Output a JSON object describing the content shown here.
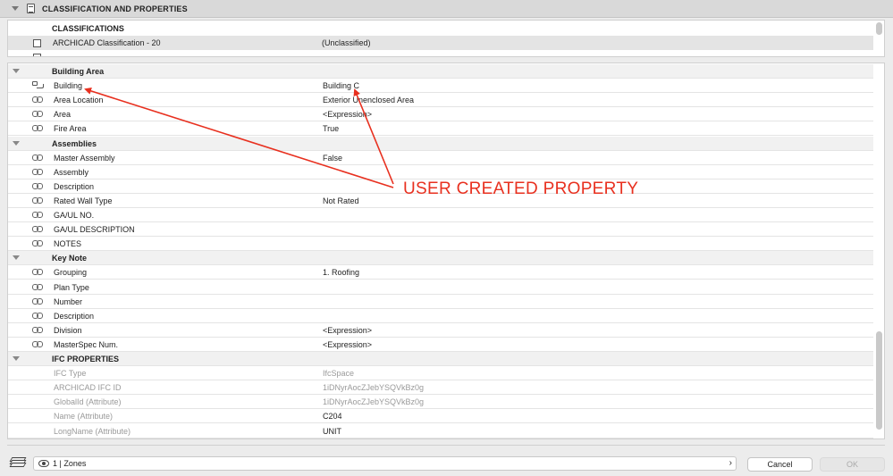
{
  "panel": {
    "title": "CLASSIFICATION AND PROPERTIES"
  },
  "classifications": {
    "header": "CLASSIFICATIONS",
    "row": {
      "name": "ARCHICAD Classification - 20",
      "value": "(Unclassified)"
    }
  },
  "rows": [
    {
      "kind": "group",
      "label": "Building Area"
    },
    {
      "kind": "prop",
      "icon": "custom",
      "label": "Building",
      "value": "Building C"
    },
    {
      "kind": "prop",
      "icon": "link",
      "label": "Area Location",
      "value": "Exterior Unenclosed Area"
    },
    {
      "kind": "prop",
      "icon": "link",
      "label": "Area",
      "value": "<Expression>"
    },
    {
      "kind": "prop",
      "icon": "link",
      "label": "Fire Area",
      "value": "True"
    },
    {
      "kind": "group",
      "label": "Assemblies"
    },
    {
      "kind": "prop",
      "icon": "link",
      "label": "Master Assembly",
      "value": "False"
    },
    {
      "kind": "prop",
      "icon": "link",
      "label": "Assembly",
      "value": ""
    },
    {
      "kind": "prop",
      "icon": "link",
      "label": "Description",
      "value": ""
    },
    {
      "kind": "prop",
      "icon": "link",
      "label": "Rated Wall Type",
      "value": "Not Rated"
    },
    {
      "kind": "prop",
      "icon": "link",
      "label": "GA/UL NO.",
      "value": ""
    },
    {
      "kind": "prop",
      "icon": "link",
      "label": "GA/UL DESCRIPTION",
      "value": ""
    },
    {
      "kind": "prop",
      "icon": "link",
      "label": "NOTES",
      "value": ""
    },
    {
      "kind": "group",
      "label": "Key Note"
    },
    {
      "kind": "prop",
      "icon": "link",
      "label": "Grouping",
      "value": "1. Roofing"
    },
    {
      "kind": "prop",
      "icon": "link",
      "label": "Plan Type",
      "value": ""
    },
    {
      "kind": "prop",
      "icon": "link",
      "label": "Number",
      "value": ""
    },
    {
      "kind": "prop",
      "icon": "link",
      "label": "Description",
      "value": ""
    },
    {
      "kind": "prop",
      "icon": "link",
      "label": "Division",
      "value": "<Expression>"
    },
    {
      "kind": "prop",
      "icon": "link",
      "label": "MasterSpec Num.",
      "value": "<Expression>"
    },
    {
      "kind": "group",
      "label": "IFC PROPERTIES"
    },
    {
      "kind": "ifc",
      "dim": true,
      "label": "IFC Type",
      "value": "IfcSpace"
    },
    {
      "kind": "ifc",
      "dim": true,
      "label": "ARCHICAD IFC ID",
      "value": "1iDNyrAocZJebYSQVkBz0g"
    },
    {
      "kind": "ifc",
      "dim": true,
      "label": "GlobalId (Attribute)",
      "value": "1iDNyrAocZJebYSQVkBz0g"
    },
    {
      "kind": "ifc",
      "dim": true,
      "strong": true,
      "label": "Name (Attribute)",
      "value": "C204"
    },
    {
      "kind": "ifc",
      "dim": true,
      "strong": true,
      "label": "LongName (Attribute)",
      "value": "UNIT"
    }
  ],
  "annotation": {
    "text": "USER CREATED PROPERTY",
    "color": "#e8301f"
  },
  "footer": {
    "selector_text": "1 | Zones",
    "cancel_label": "Cancel",
    "ok_label": "OK"
  }
}
